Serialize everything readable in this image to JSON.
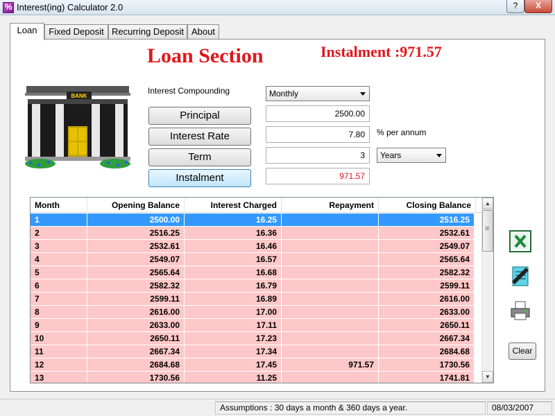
{
  "window": {
    "title": "Interest(ing) Calculator 2.0",
    "help_label": "?",
    "close_label": "X"
  },
  "tabs": [
    {
      "label": "Loan"
    },
    {
      "label": "Fixed Deposit"
    },
    {
      "label": "Recurring Deposit"
    },
    {
      "label": "About"
    }
  ],
  "loan": {
    "section_title": "Loan Section",
    "instalment_header": "Instalment :971.57",
    "bank_sign": "BANK",
    "compounding_label": "Interest Compounding",
    "compounding_value": "Monthly",
    "principal_label": "Principal",
    "principal_value": "2500.00",
    "rate_label": "Interest Rate",
    "rate_value": "7.80",
    "rate_unit": "% per annum",
    "term_label": "Term",
    "term_value": "3",
    "term_unit": "Years",
    "instalment_label": "Instalment",
    "instalment_value": "971.57"
  },
  "table": {
    "columns": [
      "Month",
      "Opening Balance",
      "Interest Charged",
      "Repayment",
      "Closing Balance"
    ],
    "rows": [
      [
        "1",
        "2500.00",
        "16.25",
        "",
        "2516.25"
      ],
      [
        "2",
        "2516.25",
        "16.36",
        "",
        "2532.61"
      ],
      [
        "3",
        "2532.61",
        "16.46",
        "",
        "2549.07"
      ],
      [
        "4",
        "2549.07",
        "16.57",
        "",
        "2565.64"
      ],
      [
        "5",
        "2565.64",
        "16.68",
        "",
        "2582.32"
      ],
      [
        "6",
        "2582.32",
        "16.79",
        "",
        "2599.11"
      ],
      [
        "7",
        "2599.11",
        "16.89",
        "",
        "2616.00"
      ],
      [
        "8",
        "2616.00",
        "17.00",
        "",
        "2633.00"
      ],
      [
        "9",
        "2633.00",
        "17.11",
        "",
        "2650.11"
      ],
      [
        "10",
        "2650.11",
        "17.23",
        "",
        "2667.34"
      ],
      [
        "11",
        "2667.34",
        "17.34",
        "",
        "2684.68"
      ],
      [
        "12",
        "2684.68",
        "17.45",
        "971.57",
        "1730.56"
      ],
      [
        "13",
        "1730.56",
        "11.25",
        "",
        "1741.81"
      ]
    ],
    "selected_row": 1
  },
  "tools": {
    "clear_label": "Clear"
  },
  "status": {
    "assumptions": "Assumptions : 30 days a month & 360 days a year.",
    "date": "08/03/2007"
  },
  "colors": {
    "accent_red": "#e0161b",
    "row_pink": "#ffc8c8",
    "selection_blue": "#3399ff"
  }
}
